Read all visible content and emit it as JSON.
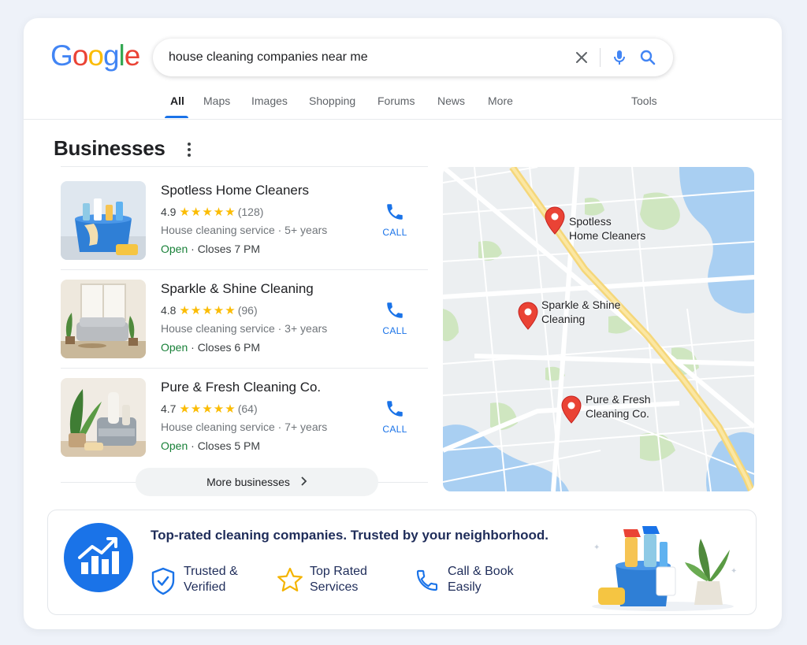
{
  "search": {
    "logo_letters": [
      "G",
      "o",
      "o",
      "g",
      "l",
      "e"
    ],
    "logo_colors": [
      "#4285F4",
      "#EA4335",
      "#FBBC05",
      "#4285F4",
      "#34A853",
      "#EA4335"
    ],
    "query": "house cleaning companies near me"
  },
  "tabs": [
    "All",
    "Maps",
    "Images",
    "Shopping",
    "Forums",
    "News",
    "More"
  ],
  "tools_label": "Tools",
  "section_title": "Businesses",
  "businesses": [
    {
      "name": "Spotless Home Cleaners",
      "rating": "4.9",
      "stars": "★★★★★",
      "reviews": "(128)",
      "description": "House cleaning service · 5+ years",
      "status": "Open",
      "closes": "· Closes 7 PM",
      "call_label": "CALL"
    },
    {
      "name": "Sparkle & Shine Cleaning",
      "rating": "4.8",
      "stars": "★★★★★",
      "reviews": "(96)",
      "description": "House cleaning service · 3+ years",
      "status": "Open",
      "closes": "· Closes 6 PM",
      "call_label": "CALL"
    },
    {
      "name": "Pure & Fresh Cleaning Co.",
      "rating": "4.7",
      "stars": "★★★★★",
      "reviews": "(64)",
      "description": "House cleaning service · 7+ years",
      "status": "Open",
      "closes": "· Closes 5 PM",
      "call_label": "CALL"
    }
  ],
  "more_businesses": "More businesses",
  "map_pins": [
    {
      "line1": "Spotless",
      "line2": "Home Cleaners"
    },
    {
      "line1": "Sparkle & Shine",
      "line2": "Cleaning"
    },
    {
      "line1": "Pure & Fresh",
      "line2": "Cleaning Co."
    }
  ],
  "banner": {
    "title": "Top-rated cleaning companies. Trusted by your neighborhood.",
    "features": [
      {
        "line1": "Trusted &",
        "line2": "Verified",
        "icon": "shield-check-icon"
      },
      {
        "line1": "Top Rated",
        "line2": "Services",
        "icon": "star-icon"
      },
      {
        "line1": "Call & Book",
        "line2": "Easily",
        "icon": "phone-icon"
      }
    ]
  },
  "colors": {
    "accent": "#1a73e8",
    "open": "#188038",
    "star": "#fbbc04",
    "pin": "#ea4335",
    "banner_text": "#1f2d5a"
  }
}
